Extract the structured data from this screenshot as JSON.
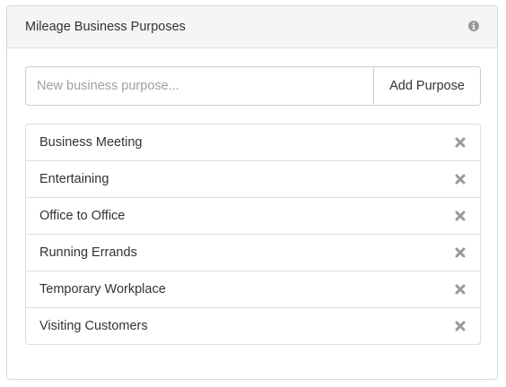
{
  "panel": {
    "title": "Mileage Business Purposes",
    "info_icon": "info-circle-icon"
  },
  "form": {
    "placeholder": "New business purpose...",
    "value": "",
    "add_label": "Add Purpose"
  },
  "purposes": [
    {
      "label": "Business Meeting",
      "remove_icon": "close-icon"
    },
    {
      "label": "Entertaining",
      "remove_icon": "close-icon"
    },
    {
      "label": "Office to Office",
      "remove_icon": "close-icon"
    },
    {
      "label": "Running Errands",
      "remove_icon": "close-icon"
    },
    {
      "label": "Temporary Workplace",
      "remove_icon": "close-icon"
    },
    {
      "label": "Visiting Customers",
      "remove_icon": "close-icon"
    }
  ],
  "colors": {
    "header_bg": "#f5f5f5",
    "border": "#dddddd",
    "icon": "#999999",
    "text": "#333333"
  }
}
